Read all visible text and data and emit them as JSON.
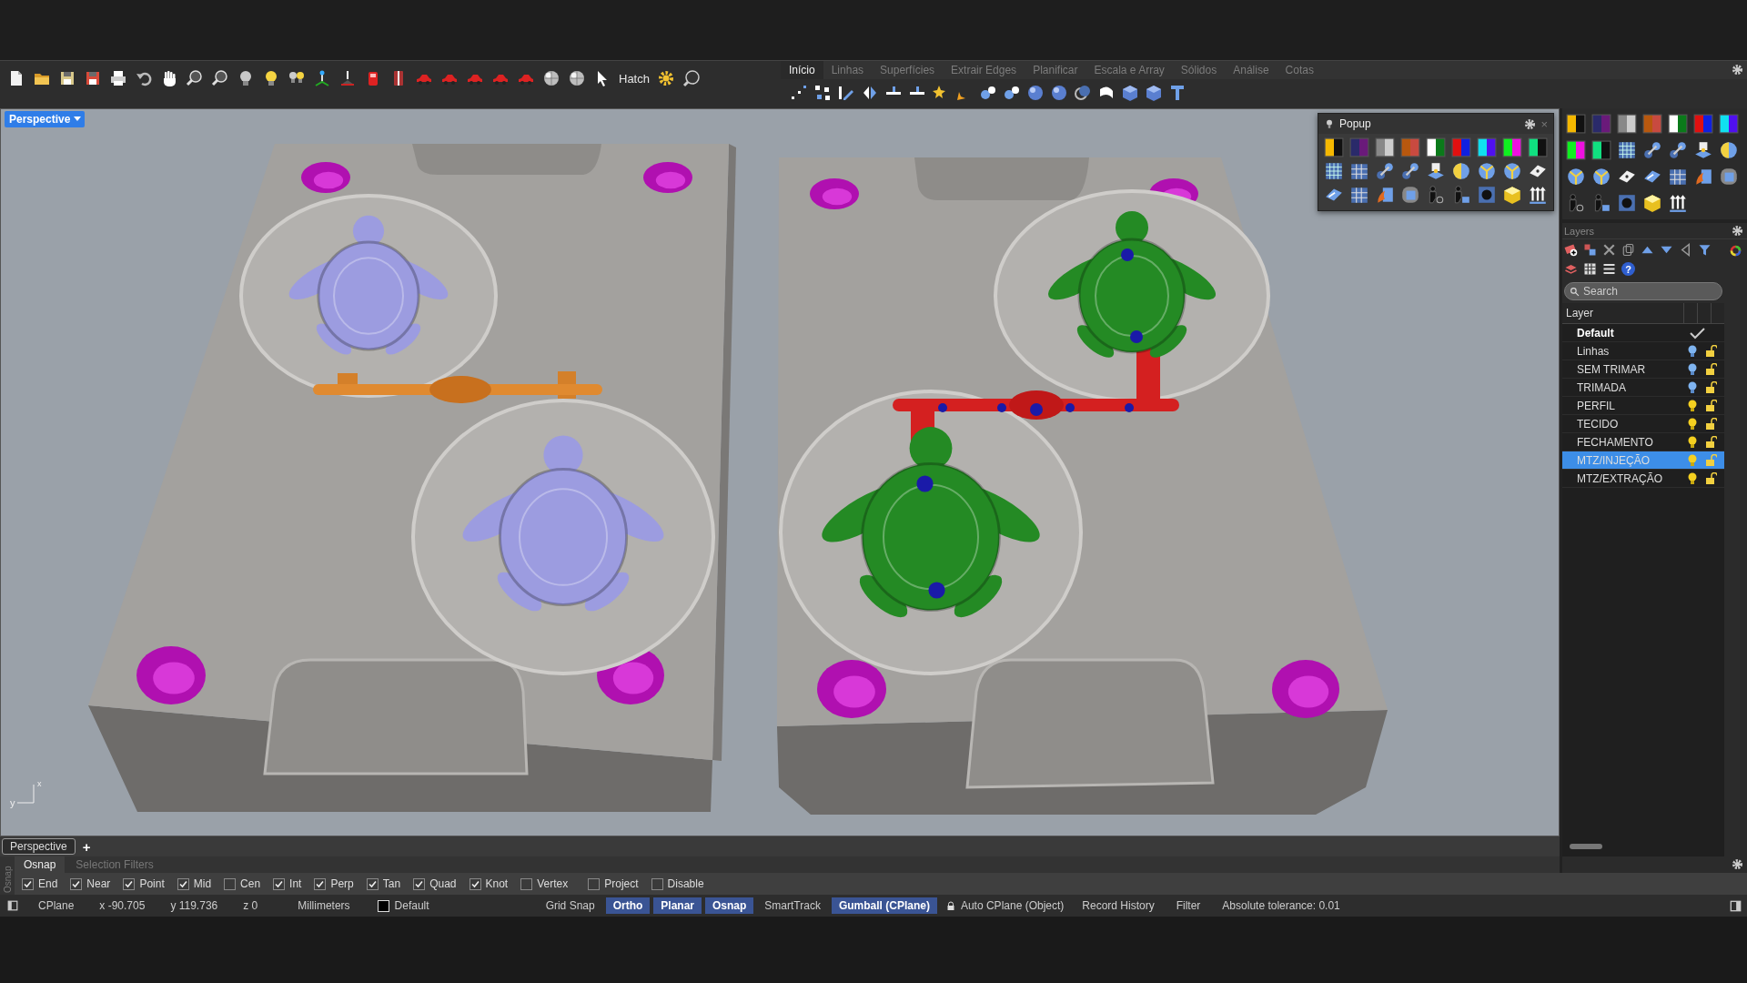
{
  "toolbar": {
    "hatch_label": "Hatch"
  },
  "ribbon_tabs": [
    {
      "label": "Início",
      "selected": true
    },
    {
      "label": "Linhas",
      "selected": false
    },
    {
      "label": "Superfícies",
      "selected": false
    },
    {
      "label": "Extrair Edges",
      "selected": false
    },
    {
      "label": "Planificar",
      "selected": false
    },
    {
      "label": "Escala e Array",
      "selected": false
    },
    {
      "label": "Sólidos",
      "selected": false
    },
    {
      "label": "Análise",
      "selected": false
    },
    {
      "label": "Cotas",
      "selected": false
    }
  ],
  "viewport": {
    "title": "Perspective",
    "axis_x": "x",
    "axis_y": "y"
  },
  "popup": {
    "title": "Popup",
    "close": "×"
  },
  "layers_panel": {
    "title": "Layers",
    "help": "?",
    "search": {
      "placeholder": "Search"
    },
    "column": "Layer",
    "layers": [
      {
        "name": "Default",
        "current": true,
        "selected": false
      },
      {
        "name": "Linhas",
        "current": false,
        "selected": false,
        "light_on": false,
        "locked": false
      },
      {
        "name": "SEM TRIMAR",
        "current": false,
        "selected": false,
        "light_on": false,
        "locked": false
      },
      {
        "name": "TRIMADA",
        "current": false,
        "selected": false,
        "light_on": false,
        "locked": false
      },
      {
        "name": "PERFIL",
        "current": false,
        "selected": false,
        "light_on": true,
        "locked": false
      },
      {
        "name": "TECIDO",
        "current": false,
        "selected": false,
        "light_on": true,
        "locked": false
      },
      {
        "name": "FECHAMENTO",
        "current": false,
        "selected": false,
        "light_on": true,
        "locked": false
      },
      {
        "name": "MTZ/INJEÇÃO",
        "current": false,
        "selected": true,
        "light_on": true,
        "locked": false
      },
      {
        "name": "MTZ/EXTRAÇÃO",
        "current": false,
        "selected": false,
        "light_on": true,
        "locked": false
      }
    ]
  },
  "viewport_tabs": [
    {
      "label": "Perspective",
      "selected": true
    }
  ],
  "add_tab": "+",
  "osnap_panel": {
    "side_label": "Osnap",
    "tabs": [
      {
        "label": "Osnap",
        "selected": true
      },
      {
        "label": "Selection Filters",
        "selected": false
      }
    ],
    "snaps": [
      {
        "label": "End",
        "checked": true
      },
      {
        "label": "Near",
        "checked": true
      },
      {
        "label": "Point",
        "checked": true
      },
      {
        "label": "Mid",
        "checked": true
      },
      {
        "label": "Cen",
        "checked": false
      },
      {
        "label": "Int",
        "checked": true
      },
      {
        "label": "Perp",
        "checked": true
      },
      {
        "label": "Tan",
        "checked": true
      },
      {
        "label": "Quad",
        "checked": true
      },
      {
        "label": "Knot",
        "checked": true
      },
      {
        "label": "Vertex",
        "checked": false
      },
      {
        "label": "Project",
        "checked": false
      },
      {
        "label": "Disable",
        "checked": false
      }
    ]
  },
  "status_bar": {
    "cplane": "CPlane",
    "x": "x -90.705",
    "y": "y 119.736",
    "z": "z 0",
    "units": "Millimeters",
    "layer": "Default",
    "toggles": [
      {
        "label": "Grid Snap",
        "on": false
      },
      {
        "label": "Ortho",
        "on": true
      },
      {
        "label": "Planar",
        "on": true
      },
      {
        "label": "Osnap",
        "on": true
      },
      {
        "label": "SmartTrack",
        "on": false
      },
      {
        "label": "Gumball (CPlane)",
        "on": true
      }
    ],
    "auto_cplane": "Auto CPlane (Object)",
    "record_history": "Record History",
    "filter": "Filter",
    "tolerance": "Absolute tolerance: 0.01"
  }
}
